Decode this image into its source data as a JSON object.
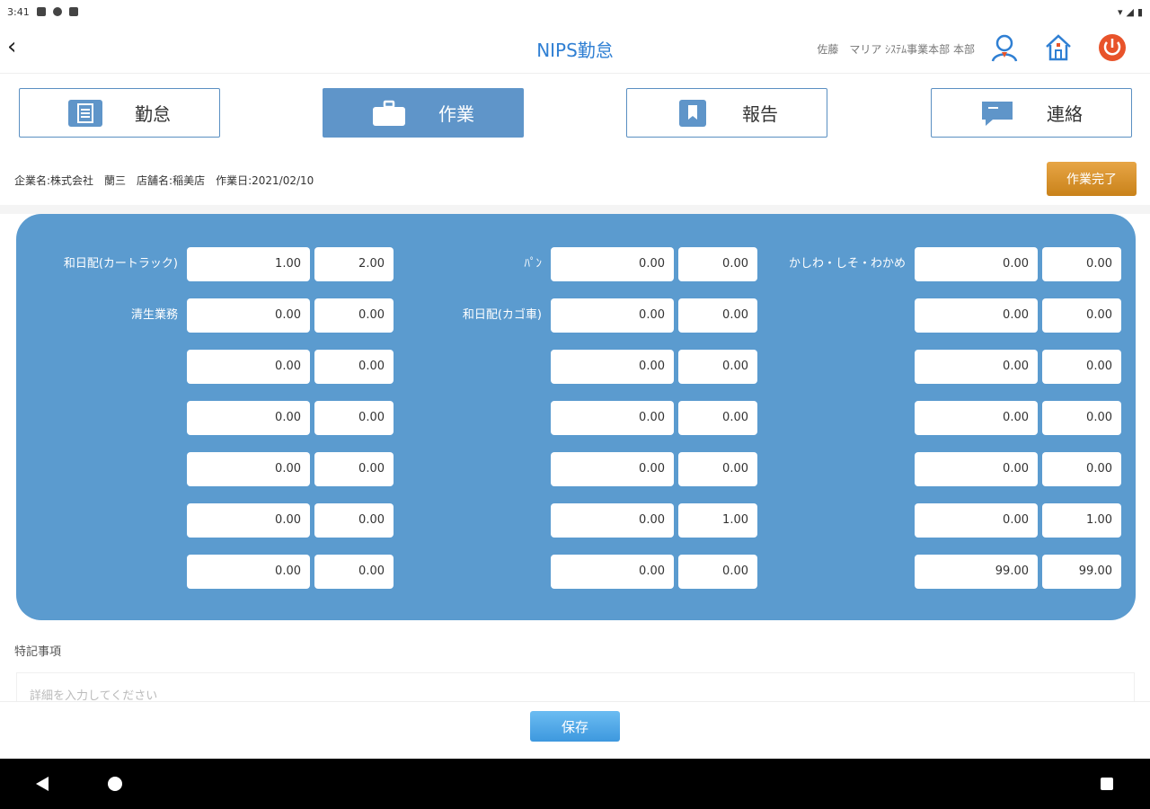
{
  "status_bar": {
    "time": "3:41"
  },
  "header": {
    "title": "NIPS勤怠",
    "user_info": "佐藤　マリア ｼｽﾃﾑ事業本部 本部"
  },
  "tabs": [
    {
      "label": "勤怠",
      "icon": "list-doc-icon"
    },
    {
      "label": "作業",
      "icon": "briefcase-icon"
    },
    {
      "label": "報告",
      "icon": "bookmark-icon"
    },
    {
      "label": "連絡",
      "icon": "chat-icon"
    }
  ],
  "info_line": "企業名:株式会社　蘭三　店舗名:稲美店　作業日:2021/02/10",
  "complete_button": "作業完了",
  "columns": [
    {
      "labels": [
        "和日配(カートラック)",
        "清生業務",
        "",
        "",
        "",
        "",
        ""
      ],
      "a": [
        "1.00",
        "0.00",
        "0.00",
        "0.00",
        "0.00",
        "0.00",
        "0.00"
      ],
      "b": [
        "2.00",
        "0.00",
        "0.00",
        "0.00",
        "0.00",
        "0.00",
        "0.00"
      ]
    },
    {
      "labels": [
        "ﾊﾟﾝ",
        "和日配(カゴ車)",
        "",
        "",
        "",
        "",
        ""
      ],
      "a": [
        "0.00",
        "0.00",
        "0.00",
        "0.00",
        "0.00",
        "0.00",
        "0.00"
      ],
      "b": [
        "0.00",
        "0.00",
        "0.00",
        "0.00",
        "0.00",
        "1.00",
        "0.00"
      ]
    },
    {
      "labels": [
        "かしわ・しそ・わかめ",
        "",
        "",
        "",
        "",
        "",
        ""
      ],
      "a": [
        "0.00",
        "0.00",
        "0.00",
        "0.00",
        "0.00",
        "0.00",
        "99.00"
      ],
      "b": [
        "0.00",
        "0.00",
        "0.00",
        "0.00",
        "0.00",
        "1.00",
        "99.00"
      ]
    }
  ],
  "remarks": {
    "label": "特記事項",
    "placeholder": "詳細を入力してください"
  },
  "save_button": "保存",
  "colors": {
    "accent": "#2f7fd3",
    "panel": "#5b9bcf",
    "complete": "#d98f2a",
    "power": "#e8532a"
  }
}
